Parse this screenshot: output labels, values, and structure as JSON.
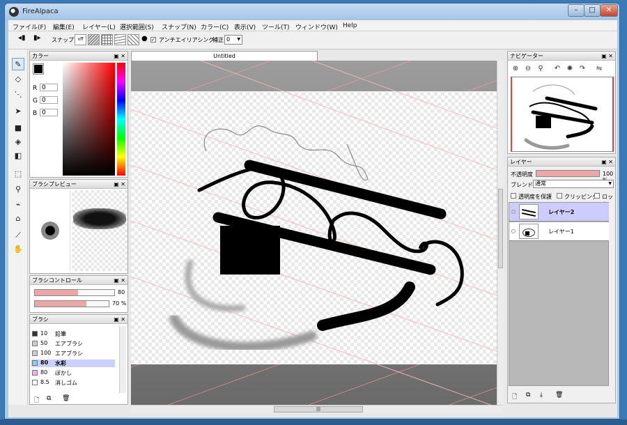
{
  "window": {
    "title": "FireAlpaca",
    "min": "–",
    "max": "□",
    "close": "✕"
  },
  "menu": [
    "ファイル(F)",
    "編集(E)",
    "レイヤー(L)",
    "選択範囲(S)",
    "スナップ(N)",
    "カラー(C)",
    "表示(V)",
    "ツール(T)",
    "ウィンドウ(W)",
    "Help"
  ],
  "toolbar": {
    "snap_label": "スナップ",
    "snap_off": "off",
    "antialias_label": "アンチエイリアシング",
    "correction_label": "補正",
    "correction_value": "0"
  },
  "document": {
    "tab_title": "Untitled"
  },
  "color_panel": {
    "title": "カラー",
    "r_label": "R",
    "g_label": "G",
    "b_label": "B",
    "r": "0",
    "g": "0",
    "b": "0"
  },
  "brush_preview_panel": {
    "title": "ブラシプレビュー"
  },
  "brush_control_panel": {
    "title": "ブラシコントロール",
    "size_value": "80",
    "opacity_value": "70 %",
    "size_fraction": 0.54,
    "opacity_fraction": 0.7
  },
  "brush_panel": {
    "title": "ブラシ",
    "items": [
      {
        "size": "10",
        "name": "鉛筆",
        "color": "#333333"
      },
      {
        "size": "50",
        "name": "エアブラシ",
        "color": "#cccccc"
      },
      {
        "size": "100",
        "name": "エアブラシ",
        "color": "#cccccc"
      },
      {
        "size": "80",
        "name": "水彩",
        "color": "#88ccff"
      },
      {
        "size": "80",
        "name": "ぼかし",
        "color": "#ffaaee"
      },
      {
        "size": "8.5",
        "name": "消しゴム",
        "color": "#ffffff"
      }
    ]
  },
  "navigator_panel": {
    "title": "ナビゲーター"
  },
  "layer_panel": {
    "title": "レイヤー",
    "opacity_label": "不透明度",
    "opacity_value": "100 %",
    "blend_label": "ブレンド",
    "blend_value": "通常",
    "protect_label": "透明度を保護",
    "clipping_label": "クリッピング",
    "lock_label": "ロック",
    "layers": [
      {
        "name": "レイヤー2"
      },
      {
        "name": "レイヤー1"
      }
    ]
  },
  "colors": {
    "accent": "#ccccff",
    "slider_fill": "#eba6a6",
    "window_frame": "#a9c9e9"
  }
}
